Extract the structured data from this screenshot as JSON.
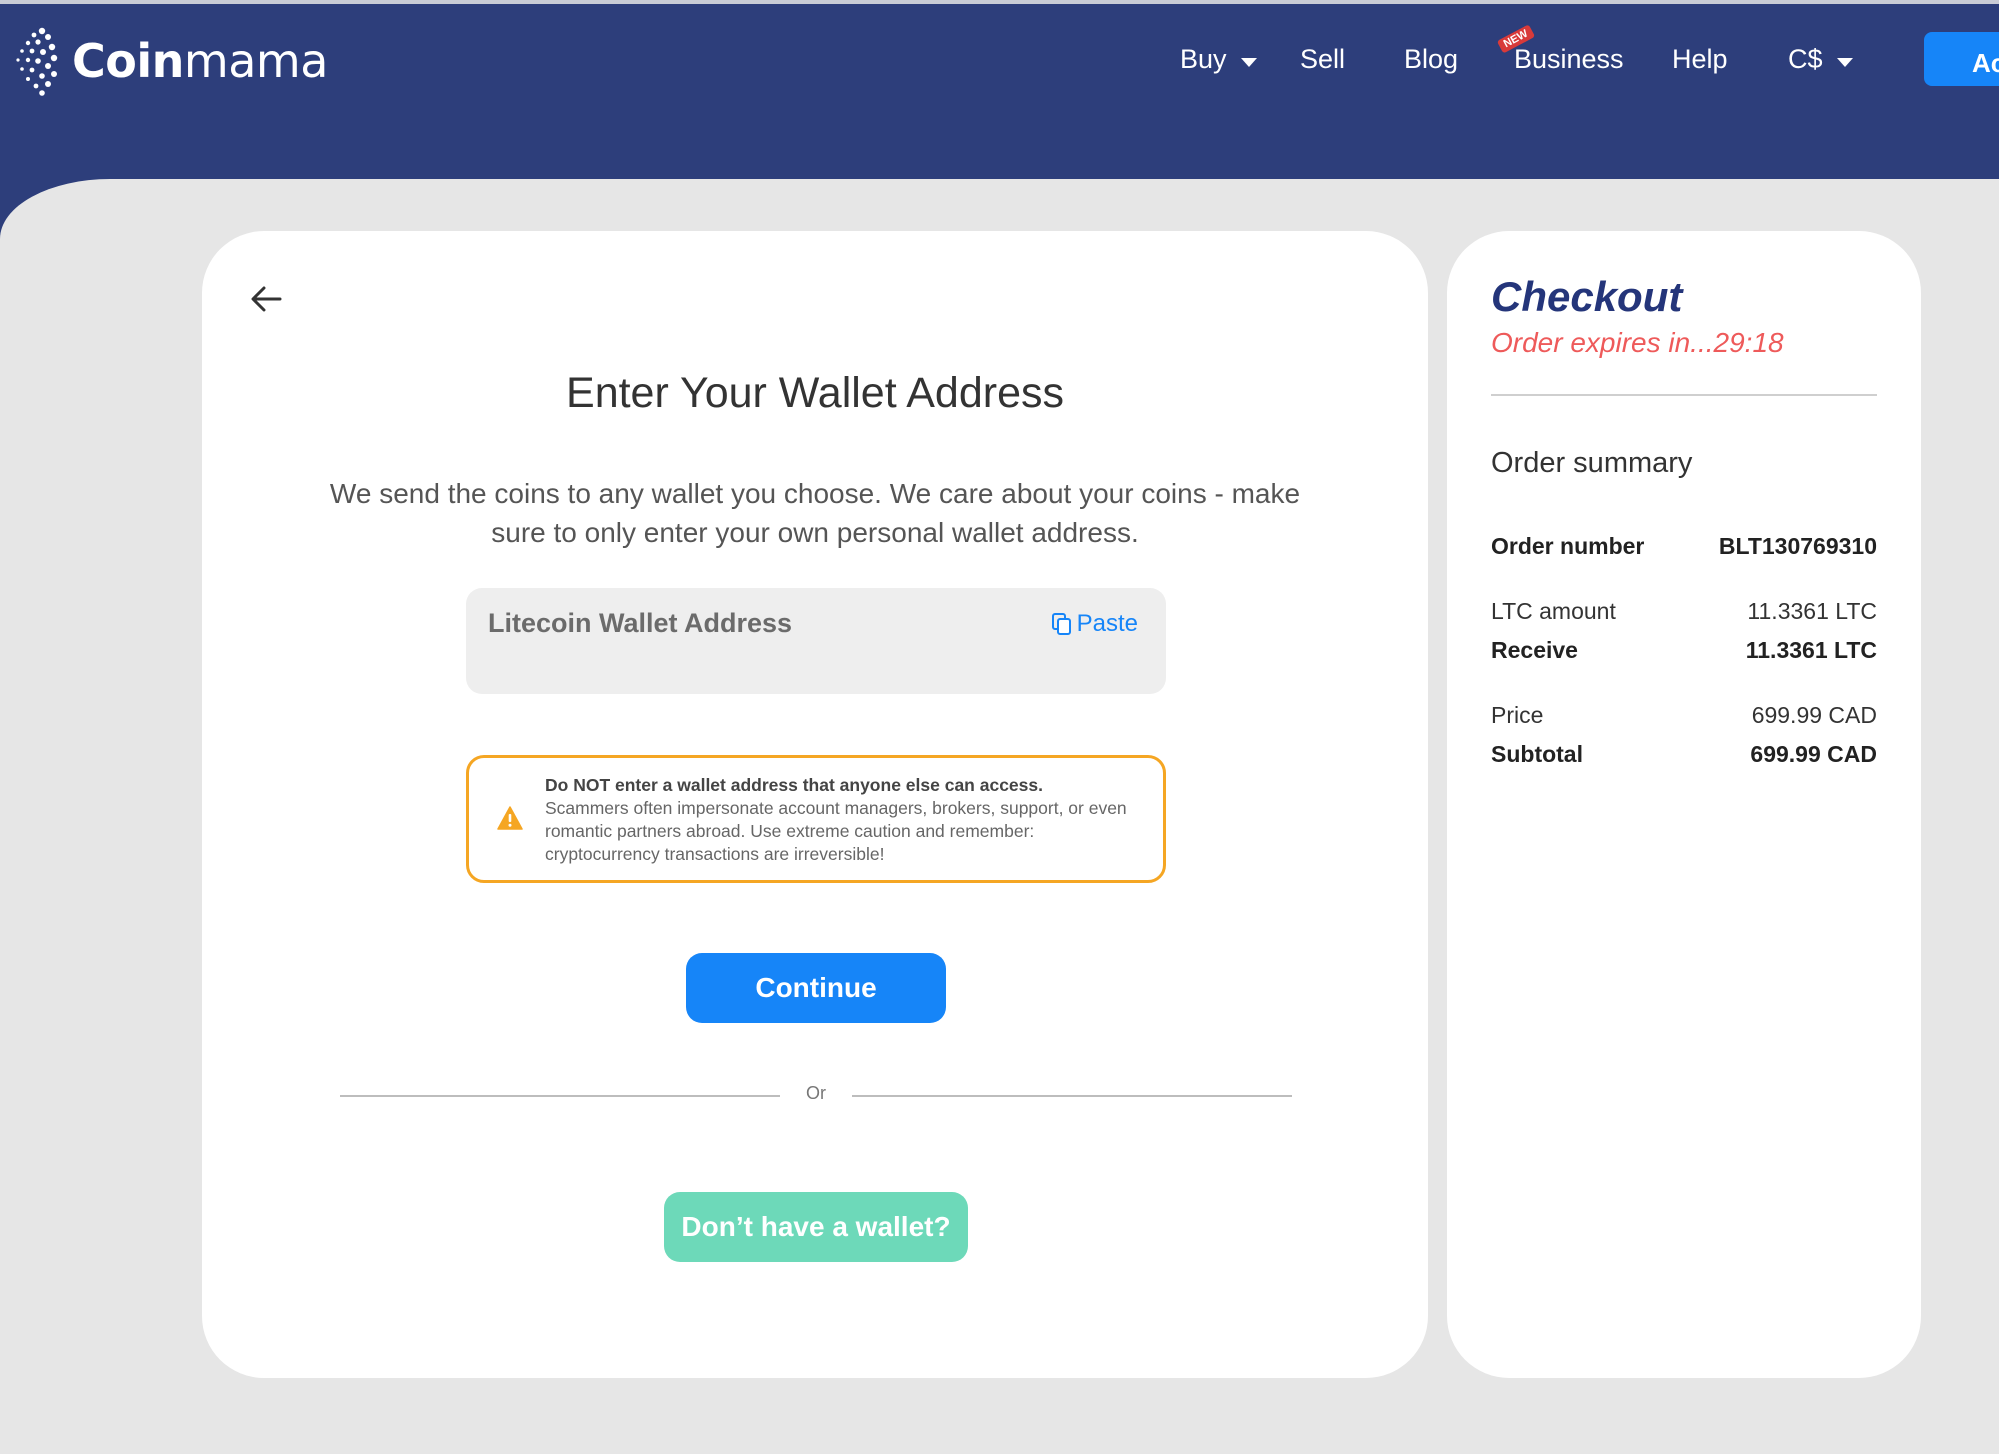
{
  "header": {
    "logo_bold": "Coin",
    "logo_regular": "mama",
    "nav": [
      {
        "label": "Buy",
        "has_caret": true
      },
      {
        "label": "Sell"
      },
      {
        "label": "Blog"
      },
      {
        "label": "Business",
        "badge": "NEW"
      },
      {
        "label": "Help"
      },
      {
        "label": "C$",
        "has_caret": true
      }
    ],
    "account_button": "Ac"
  },
  "wallet_form": {
    "title": "Enter Your Wallet Address",
    "description": "We send the coins to any wallet you choose. We care about your coins - make sure to only enter your own personal wallet address.",
    "input_label": "Litecoin Wallet Address",
    "paste_label": "Paste",
    "warning_bold": "Do NOT enter a wallet address that anyone else can access.",
    "warning_body": "Scammers often impersonate account managers, brokers, support, or even romantic partners abroad. Use extreme caution and remember: cryptocurrency transactions are irreversible!",
    "continue_label": "Continue",
    "or_label": "Or",
    "no_wallet_label": "Don’t have a wallet?"
  },
  "checkout": {
    "title": "Checkout",
    "expires": "Order expires in...29:18",
    "summary_title": "Order summary",
    "rows": [
      {
        "label": "Order number",
        "value": "BLT130769310",
        "bold": true
      },
      {
        "label": "LTC amount",
        "value": "11.3361 LTC"
      },
      {
        "label": "Receive",
        "value": "11.3361 LTC",
        "bold": true
      },
      {
        "label": "Price",
        "value": "699.99 CAD"
      },
      {
        "label": "Subtotal",
        "value": "699.99 CAD",
        "bold": true
      }
    ]
  },
  "colors": {
    "header_bg": "#2d3e7b",
    "primary": "#1685f8",
    "secondary_button": "#6dd9b9",
    "warning_border": "#f5a623",
    "expires_text": "#ee5a5a"
  }
}
